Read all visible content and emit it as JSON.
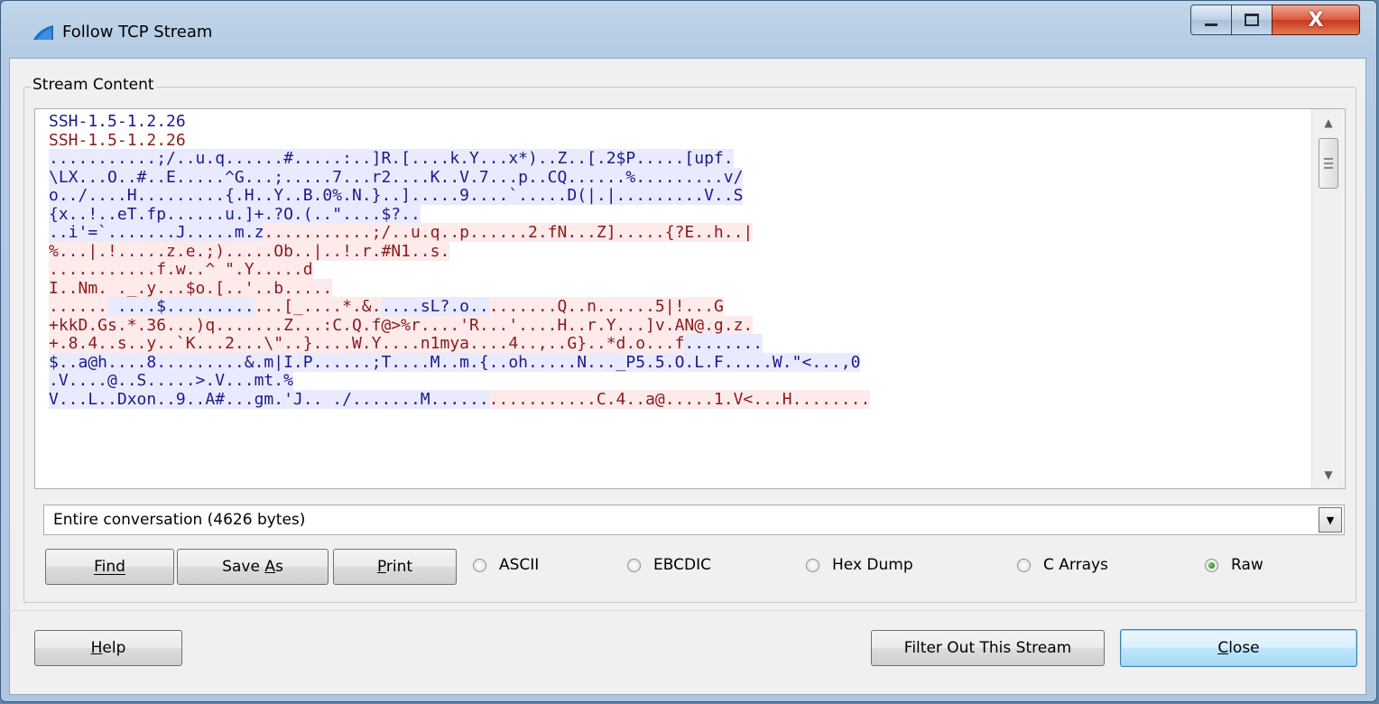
{
  "window": {
    "title": "Follow TCP Stream",
    "close_glyph": "X"
  },
  "group": {
    "legend": "Stream Content"
  },
  "stream": {
    "lines": [
      {
        "segs": [
          {
            "t": "SSH-1.5-1.2.26",
            "k": "c"
          }
        ]
      },
      {
        "segs": [
          {
            "t": "SSH-1.5-1.2.26",
            "k": "s"
          }
        ]
      },
      {
        "segs": [
          {
            "t": "...........;/..u.q......#.....:..]R.[....k.Y...x*)..Z..[.2$P.....[upf.",
            "k": "c"
          }
        ]
      },
      {
        "segs": [
          {
            "t": "\\LX...O..#..E.....^G...;.....7...r2....K..V.7...p..CQ......%.........v/",
            "k": "c"
          }
        ]
      },
      {
        "segs": [
          {
            "t": "o../....H.........{.H..Y..B.0%.N.}..].....9....`.....D(|.|.........V..S",
            "k": "c"
          }
        ]
      },
      {
        "segs": [
          {
            "t": "{x..!..eT.fp......u.]+.?O.(..\"....$?..",
            "k": "c"
          }
        ]
      },
      {
        "segs": [
          {
            "t": "..i'=`.......J.....m.z",
            "k": "c"
          },
          {
            "t": "...........;/..u.q..p......2.fN...Z].....{?E..h..|",
            "k": "s"
          }
        ]
      },
      {
        "segs": [
          {
            "t": "%...|.!.....z.e.;).....Ob..|..!.r.#N1..s.",
            "k": "s"
          }
        ]
      },
      {
        "segs": [
          {
            "t": "...........f.w..^ \".Y.....d",
            "k": "s"
          }
        ]
      },
      {
        "segs": [
          {
            "t": "I..Nm. ._.y...$o.[..'..b.....",
            "k": "s"
          }
        ]
      },
      {
        "segs": [
          {
            "t": "......",
            "k": "s"
          },
          {
            "t": " ....$.........",
            "k": "c"
          },
          {
            "t": "...[_....*.&.",
            "k": "s"
          },
          {
            "t": "....sL?.o..",
            "k": "c"
          },
          {
            "t": ".......Q..n......5|!...G",
            "k": "s"
          }
        ]
      },
      {
        "segs": [
          {
            "t": "+kkD.Gs.*.36...)q.......Z...:C.Q.f@>%r....'R...'....H..r.Y...]v.AN@.g.z.",
            "k": "s"
          }
        ]
      },
      {
        "segs": [
          {
            "t": "+.8.4..s..y..`K...2...\\\"..}....W.Y....n1mya....4..,..G}..*d.o...f",
            "k": "s"
          },
          {
            "t": "........",
            "k": "c"
          }
        ]
      },
      {
        "segs": [
          {
            "t": "$..a@h....8.........&.m|I.P......;T....M..m.{..oh.....N..._P5.5.O.L.F.....W.\"<...,0",
            "k": "c"
          }
        ]
      },
      {
        "segs": [
          {
            "t": ".V....@..S.....>.V...mt.%",
            "k": "c"
          }
        ]
      },
      {
        "segs": [
          {
            "t": "V...L..Dxon..9..A#...gm.'J.. ./.......M......",
            "k": "c"
          },
          {
            "t": "...........C.4..a@.....1.V<...H........",
            "k": "s"
          }
        ]
      }
    ]
  },
  "conversation": {
    "selected": "Entire conversation (4626 bytes)"
  },
  "buttons": {
    "find": "Find",
    "save_as": "Save As",
    "print": "Print",
    "help": "Help",
    "filter_out": "Filter Out This Stream",
    "close": "Close"
  },
  "modes": [
    {
      "label": "ASCII",
      "checked": false
    },
    {
      "label": "EBCDIC",
      "checked": false
    },
    {
      "label": "Hex Dump",
      "checked": false
    },
    {
      "label": "C Arrays",
      "checked": false
    },
    {
      "label": "Raw",
      "checked": true
    }
  ],
  "colors": {
    "client_fg": "#1a1a8c",
    "client_bg": "#eaeaff",
    "server_fg": "#8c1a1a",
    "server_bg": "#fdeaea"
  }
}
